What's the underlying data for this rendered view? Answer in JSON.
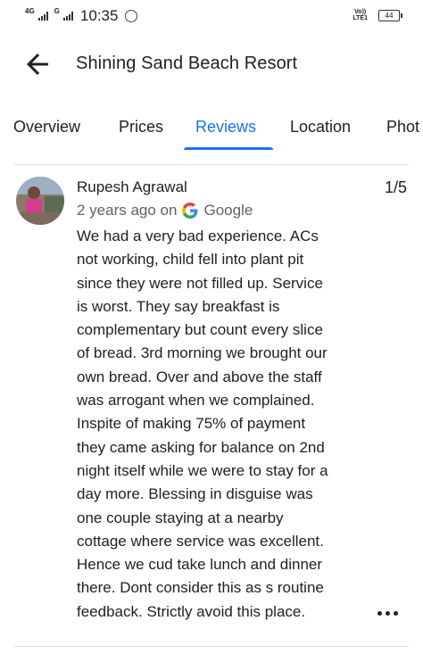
{
  "status_bar": {
    "network_1": "4G",
    "network_2": "G",
    "time": "10:35",
    "volte": "Vo))\nLTE1",
    "battery": "44"
  },
  "header": {
    "title": "Shining Sand Beach Resort"
  },
  "tabs": [
    {
      "label": "Overview",
      "active": false
    },
    {
      "label": "Prices",
      "active": false
    },
    {
      "label": "Reviews",
      "active": true
    },
    {
      "label": "Location",
      "active": false
    },
    {
      "label": "Phot",
      "active": false
    }
  ],
  "accent_color": "#1a73e8",
  "review": {
    "reviewer": "Rupesh Agrawal",
    "rating": "1/5",
    "time_ago": "2 years ago on",
    "source": "Google",
    "lines": [
      "We had a very bad experience. ACs",
      "not working, child fell into plant pit",
      "since they were not filled up. Service",
      "is worst. They say breakfast is",
      "complementary but count every slice",
      "of bread. 3rd morning we brought our",
      "own bread. Over and above the staff",
      "was arrogant when we complained.",
      "Inspite of making 75% of payment",
      "they came asking for balance on 2nd",
      "night itself while we were to stay for a",
      "day more. Blessing in disguise was",
      "one couple staying at a nearby",
      "cottage where service was excellent.",
      "Hence we cud take lunch and dinner",
      "there. Dont consider this as s routine",
      "feedback. Strictly avoid this place."
    ]
  },
  "icons": {
    "back": "arrow-back-icon",
    "source": "google-g-icon",
    "more": "more-horiz-icon"
  }
}
